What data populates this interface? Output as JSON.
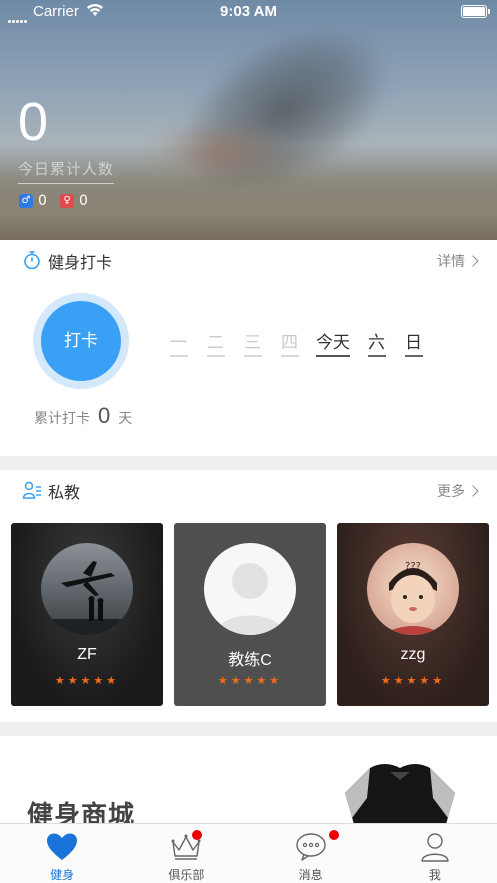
{
  "status_bar": {
    "carrier": "Carrier",
    "time": "9:03 AM"
  },
  "hero": {
    "today_count": "0",
    "today_count_label": "今日累计人数",
    "male_count": "0",
    "female_count": "0",
    "male_icon": "male-icon",
    "female_icon": "female-icon"
  },
  "checkin": {
    "title": "健身打卡",
    "more_label": "详情",
    "button_label": "打卡",
    "days": [
      "一",
      "二",
      "三",
      "四",
      "今天",
      "六",
      "日"
    ],
    "total_prefix": "累计打卡",
    "total_value": "0",
    "total_suffix": "天"
  },
  "trainers": {
    "title": "私教",
    "more_label": "更多",
    "items": [
      {
        "name": "ZF",
        "rating": 5
      },
      {
        "name": "教练C",
        "rating": 5
      },
      {
        "name": "zzg",
        "rating": 5
      }
    ],
    "avatar_overlay_text": "???"
  },
  "mall": {
    "title": "健身商城"
  },
  "tabbar": {
    "items": [
      {
        "label": "健身",
        "icon": "heart-icon",
        "active": true,
        "badge": false
      },
      {
        "label": "俱乐部",
        "icon": "crown-icon",
        "active": false,
        "badge": true
      },
      {
        "label": "消息",
        "icon": "chat-bubble-icon",
        "active": false,
        "badge": true
      },
      {
        "label": "我",
        "icon": "person-icon",
        "active": false,
        "badge": false
      }
    ]
  },
  "colors": {
    "accent": "#3aa0f5",
    "tab_active": "#1a73d9",
    "star": "#f36b1c",
    "badge": "#ee0000"
  }
}
